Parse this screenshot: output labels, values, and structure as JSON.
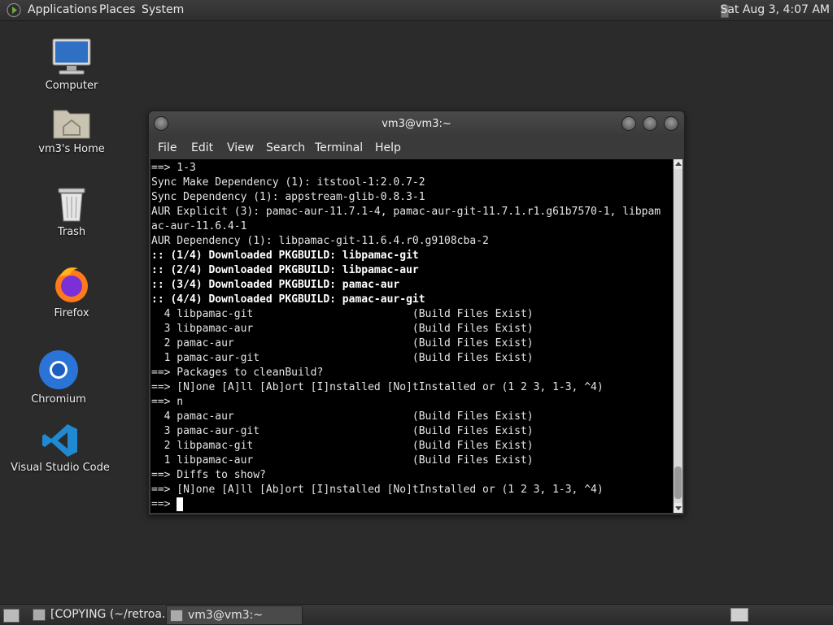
{
  "top_panel": {
    "applications": "Applications",
    "places": "Places",
    "system": "System",
    "clock": "Sat Aug  3,  4:07 AM"
  },
  "desktop": {
    "icons": [
      {
        "label": "Computer",
        "icon": "computer-icon"
      },
      {
        "label": "vm3's Home",
        "icon": "home-folder-icon"
      },
      {
        "label": "Trash",
        "icon": "trash-icon"
      },
      {
        "label": "Firefox",
        "icon": "firefox-icon"
      },
      {
        "label": "Chromium",
        "icon": "chromium-icon"
      },
      {
        "label": "Visual Studio Code",
        "icon": "vscode-icon"
      }
    ]
  },
  "terminal": {
    "title": "vm3@vm3:~",
    "menu": [
      "File",
      "Edit",
      "View",
      "Search",
      "Terminal",
      "Help"
    ],
    "lines": [
      "==> 1-3",
      "Sync Make Dependency (1): itstool-1:2.0.7-2",
      "Sync Dependency (1): appstream-glib-0.8.3-1",
      "AUR Explicit (3): pamac-aur-11.7.1-4, pamac-aur-git-11.7.1.r1.g61b7570-1, libpam",
      "ac-aur-11.6.4-1",
      "AUR Dependency (1): libpamac-git-11.6.4.r0.g9108cba-2",
      ":: (1/4) Downloaded PKGBUILD: libpamac-git",
      ":: (2/4) Downloaded PKGBUILD: libpamac-aur",
      ":: (3/4) Downloaded PKGBUILD: pamac-aur",
      ":: (4/4) Downloaded PKGBUILD: pamac-aur-git",
      "  4 libpamac-git                         (Build Files Exist)",
      "  3 libpamac-aur                         (Build Files Exist)",
      "  2 pamac-aur                            (Build Files Exist)",
      "  1 pamac-aur-git                        (Build Files Exist)",
      "==> Packages to cleanBuild?",
      "==> [N]one [A]ll [Ab]ort [I]nstalled [No]tInstalled or (1 2 3, 1-3, ^4)",
      "==> n",
      "  4 pamac-aur                            (Build Files Exist)",
      "  3 pamac-aur-git                        (Build Files Exist)",
      "  2 libpamac-git                         (Build Files Exist)",
      "  1 libpamac-aur                         (Build Files Exist)",
      "==> Diffs to show?",
      "==> [N]one [A]ll [Ab]ort [I]nstalled [No]tInstalled or (1 2 3, 1-3, ^4)"
    ],
    "bold_lines": [
      6,
      7,
      8,
      9
    ],
    "prompt": "==> "
  },
  "bottom_panel": {
    "tasks": [
      {
        "label": "[COPYING (~/retroa..."
      },
      {
        "label": "vm3@vm3:~"
      }
    ]
  }
}
